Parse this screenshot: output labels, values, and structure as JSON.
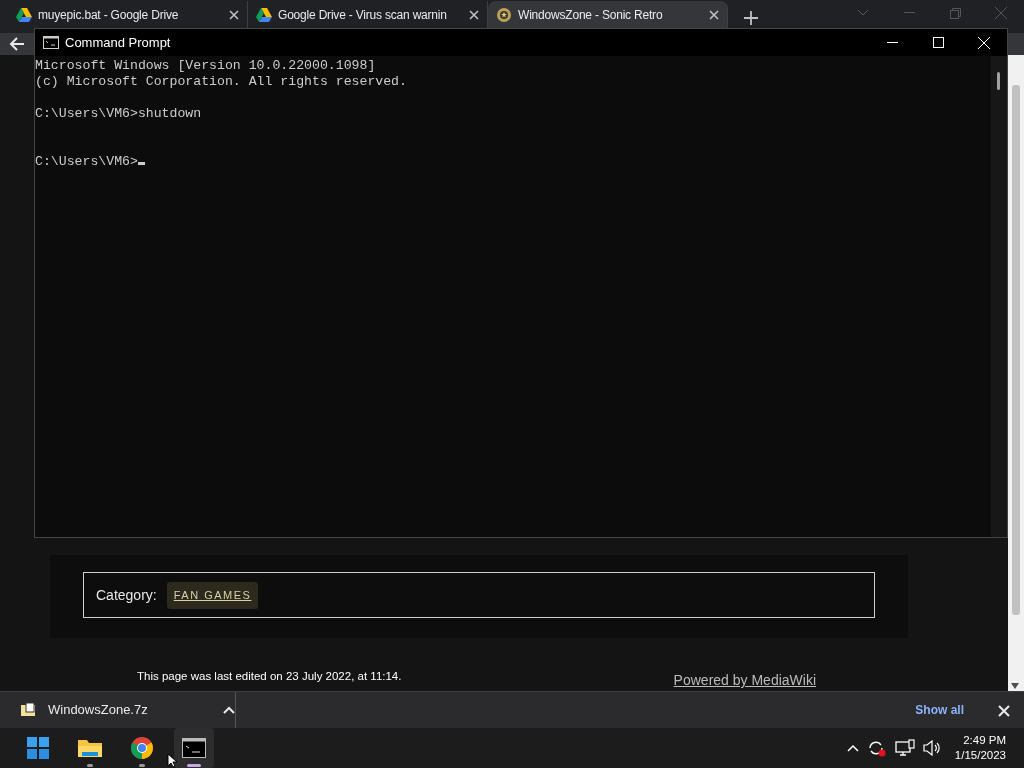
{
  "browser": {
    "tabs": [
      {
        "title": "muyepic.bat - Google Drive",
        "kind": "drive",
        "selected": false
      },
      {
        "title": "Google Drive - Virus scan warnin",
        "kind": "drive",
        "selected": false
      },
      {
        "title": "WindowsZone - Sonic Retro",
        "kind": "ring",
        "selected": true
      }
    ]
  },
  "page": {
    "category_label": "Category:",
    "category": "FAN GAMES",
    "footer_left": "This page was last edited on 23 July 2022, at 11:14.",
    "footer_right": "Powered by MediaWiki"
  },
  "console": {
    "title": "Command Prompt",
    "lines": [
      {
        "kind": "banner",
        "text": "Microsoft Windows [Version 10.0.22000.1098]"
      },
      {
        "kind": "banner",
        "text": "(c) Microsoft Corporation. All rights reserved."
      },
      {
        "kind": "command",
        "text": "C:\\Users\\VM6>shutdown"
      },
      {
        "kind": "prompt",
        "text": "C:\\Users\\VM6>"
      }
    ],
    "cursor": true
  },
  "downloads": {
    "file": "WindowsZone.7z",
    "show_all": "Show all"
  },
  "taskbar": {
    "apps": [
      {
        "kind": "start",
        "running": false,
        "selected": false
      },
      {
        "kind": "explorer",
        "running": true,
        "selected": false
      },
      {
        "kind": "chrome",
        "running": true,
        "selected": false
      },
      {
        "kind": "terminal",
        "running": true,
        "selected": true
      }
    ],
    "time": "2:49 PM",
    "date": "1/15/2023"
  }
}
